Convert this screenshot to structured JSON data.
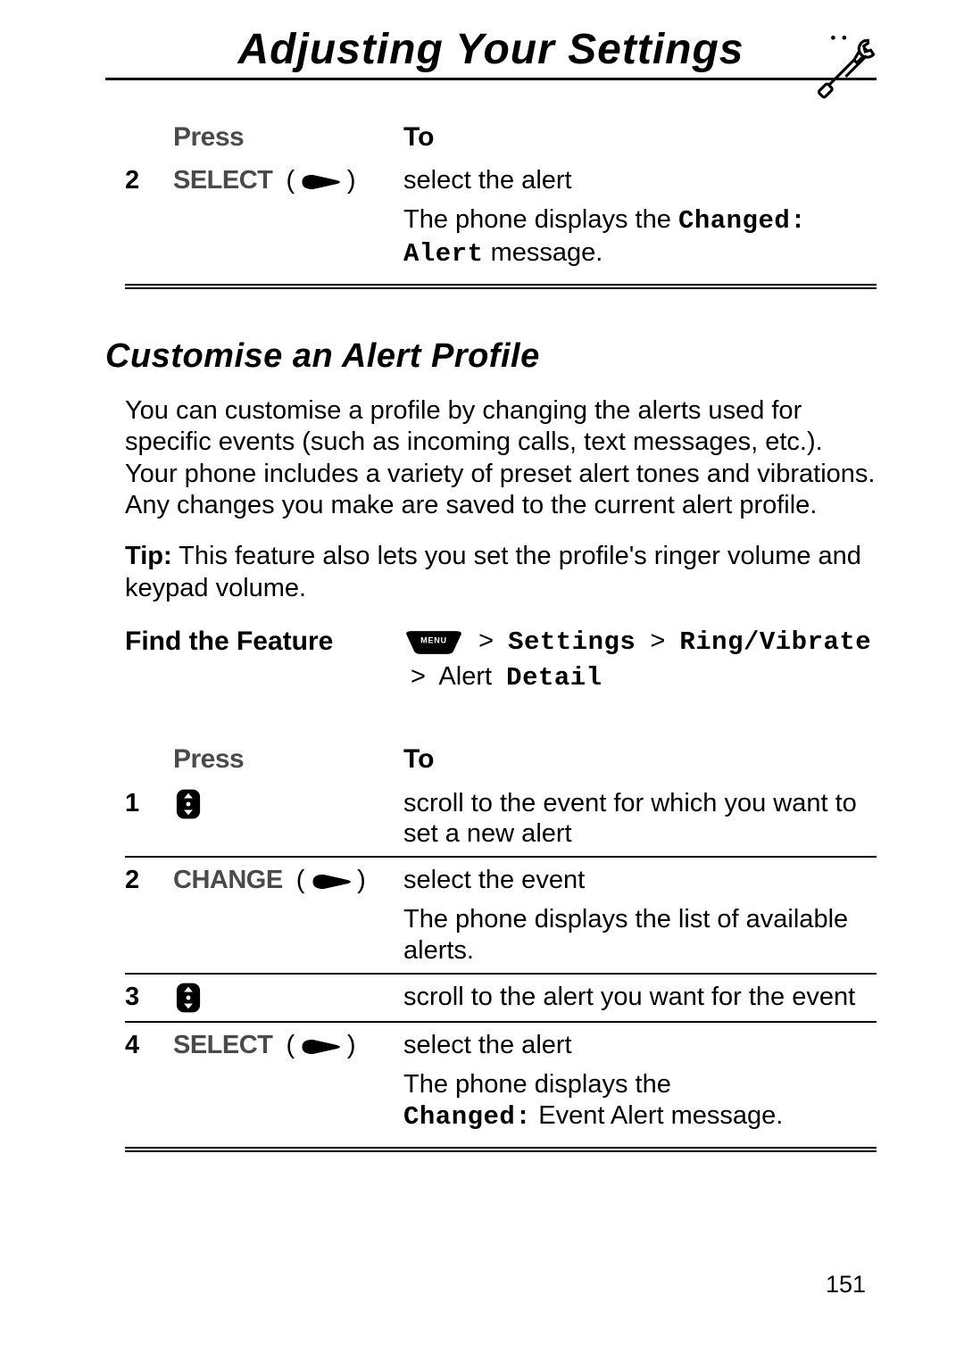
{
  "header": {
    "title": "Adjusting Your Settings"
  },
  "table1": {
    "headers": {
      "press": "Press",
      "to": "To"
    },
    "rows": [
      {
        "num": "2",
        "key_label": "SELECT",
        "key_icon": "softkey",
        "to_line1": "select the alert",
        "to_line2a": "The phone displays the ",
        "to_line2b_mono_bold": "Changed:",
        "to_line3a_mono_bold": "Alert",
        "to_line3b": " message."
      }
    ]
  },
  "section": {
    "heading": "Customise an Alert Profile",
    "para1": "You can customise a profile by changing the alerts used for specific events (such as incoming calls, text messages, etc.). Your phone includes a variety of preset alert tones and vibrations. Any changes you make are saved to the current alert profile.",
    "tip_label": "Tip:",
    "tip_text": " This feature also lets you set the profile's ringer volume and keypad volume."
  },
  "find_feature": {
    "label": "Find the Feature",
    "gt": ">",
    "settings": "Settings",
    "ring_vibrate": "Ring/Vibrate",
    "alert_word": "Alert",
    "detail_word": "Detail"
  },
  "table2": {
    "headers": {
      "press": "Press",
      "to": "To"
    },
    "rows": [
      {
        "num": "1",
        "key_icon": "nav",
        "to_line1": "scroll to the event for which you want to set a new alert"
      },
      {
        "num": "2",
        "key_label": "CHANGE",
        "key_icon": "softkey",
        "to_line1": "select the event",
        "to_line2": "The phone displays the list of available alerts."
      },
      {
        "num": "3",
        "key_icon": "nav",
        "to_line1": "scroll to the alert you want for the event"
      },
      {
        "num": "4",
        "key_label": "SELECT",
        "key_icon": "softkey",
        "to_line1": "select the alert",
        "to_line2a": "The phone displays the ",
        "to_line2b_mono_bold": "Changed:",
        "to_line2c": " Event Alert message."
      }
    ]
  },
  "page_number": "151"
}
